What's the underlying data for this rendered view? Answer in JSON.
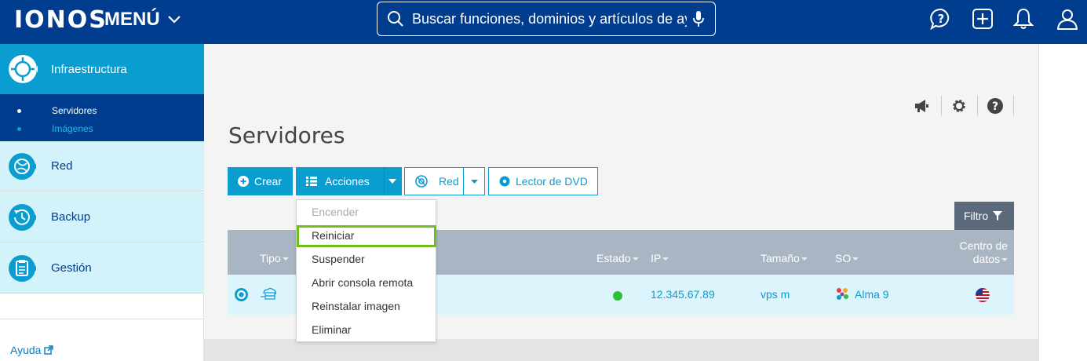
{
  "header": {
    "logo": "IONOS",
    "menu_label": "MENÚ",
    "search_placeholder": "Buscar funciones, dominios y artículos de ay..."
  },
  "sidebar": {
    "active": {
      "label": "Infraestructura"
    },
    "sub_items": [
      {
        "label": "Servidores",
        "active": true
      },
      {
        "label": "Imágenes",
        "active": false
      }
    ],
    "items": [
      {
        "label": "Red"
      },
      {
        "label": "Backup"
      },
      {
        "label": "Gestión"
      }
    ],
    "help": "Ayuda"
  },
  "page": {
    "title": "Servidores"
  },
  "toolbar": {
    "create": "Crear",
    "actions": "Acciones",
    "network": "Red",
    "dvd": "Lector de DVD",
    "filter": "Filtro"
  },
  "dropdown": {
    "items": [
      {
        "label": "Encender",
        "disabled": true
      },
      {
        "label": "Reiniciar",
        "highlighted": true
      },
      {
        "label": "Suspender"
      },
      {
        "label": "Abrir consola remota"
      },
      {
        "label": "Reinstalar imagen"
      },
      {
        "label": "Eliminar"
      }
    ]
  },
  "table": {
    "columns": {
      "tipo": "Tipo",
      "estado": "Estado",
      "ip": "IP",
      "tamano": "Tamaño",
      "so": "SO",
      "centro_line1": "Centro de",
      "centro_line2": "datos"
    },
    "rows": [
      {
        "ip": "12.345.67.89",
        "size": "vps m",
        "os": "Alma 9",
        "status_color": "#2bbf3a"
      }
    ]
  },
  "colors": {
    "header_bg": "#003d8f",
    "accent": "#0a9ed0",
    "highlight": "#6fbe1e"
  }
}
